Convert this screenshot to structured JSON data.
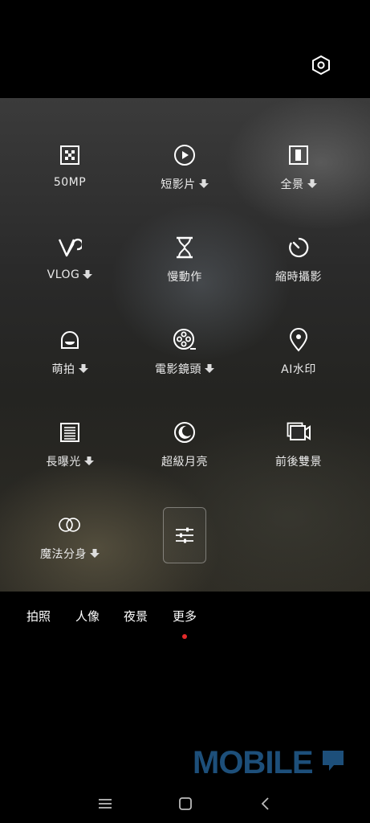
{
  "tiles": [
    {
      "label": "50MP",
      "icon": "grid-dots-icon",
      "download": false
    },
    {
      "label": "短影片",
      "icon": "play-circle-icon",
      "download": true
    },
    {
      "label": "全景",
      "icon": "panorama-icon",
      "download": true
    },
    {
      "label": "VLOG",
      "icon": "vlog-icon",
      "download": true
    },
    {
      "label": "慢動作",
      "icon": "hourglass-icon",
      "download": false
    },
    {
      "label": "縮時攝影",
      "icon": "timer-icon",
      "download": false
    },
    {
      "label": "萌拍",
      "icon": "cute-face-icon",
      "download": true
    },
    {
      "label": "電影鏡頭",
      "icon": "film-reel-icon",
      "download": true
    },
    {
      "label": "AI水印",
      "icon": "location-pin-icon",
      "download": false
    },
    {
      "label": "長曝光",
      "icon": "long-exposure-icon",
      "download": true
    },
    {
      "label": "超級月亮",
      "icon": "moon-icon",
      "download": false
    },
    {
      "label": "前後雙景",
      "icon": "dual-view-icon",
      "download": false
    },
    {
      "label": "魔法分身",
      "icon": "clone-icon",
      "download": true
    }
  ],
  "edit": {
    "icon": "sliders-icon"
  },
  "modes": [
    "拍照",
    "人像",
    "夜景",
    "更多"
  ],
  "active_mode": "更多",
  "watermark": {
    "text": "MOBILE",
    "color": "#1d4f7a"
  },
  "colors": {
    "accent_dot": "#e32a2a"
  }
}
